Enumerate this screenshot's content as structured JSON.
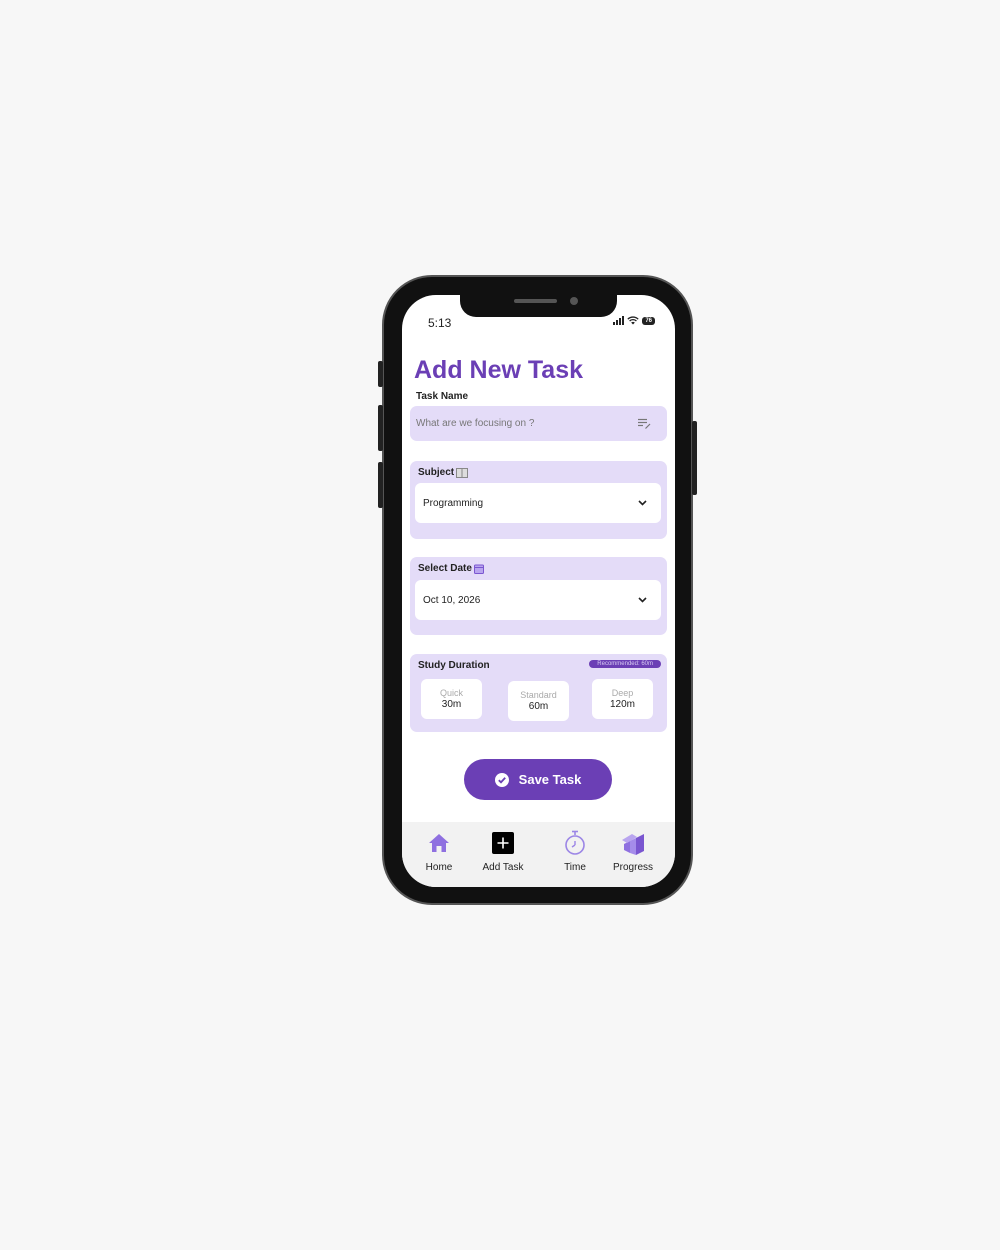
{
  "status": {
    "time": "5:13",
    "battery": "76"
  },
  "title": "Add New Task",
  "task_name": {
    "label": "Task Name",
    "placeholder": "What are we focusing on ?"
  },
  "subject": {
    "label": "Subject",
    "value": "Programming"
  },
  "date": {
    "label": "Select Date",
    "value": "Oct 10, 2026"
  },
  "duration": {
    "label": "Study Duration",
    "badge": "Recommended: 60m",
    "options": [
      {
        "name": "Quick",
        "value": "30m"
      },
      {
        "name": "Standard",
        "value": "60m"
      },
      {
        "name": "Deep",
        "value": "120m"
      }
    ]
  },
  "save_label": "Save Task",
  "nav": [
    {
      "label": "Home",
      "icon": "home-icon"
    },
    {
      "label": "Add Task",
      "icon": "plus-icon"
    },
    {
      "label": "Time",
      "icon": "stopwatch-icon"
    },
    {
      "label": "Progress",
      "icon": "progress-icon"
    }
  ],
  "colors": {
    "accent": "#6b3fb5",
    "card": "#e4dcf8",
    "nav_icon": "#8f70e0"
  }
}
